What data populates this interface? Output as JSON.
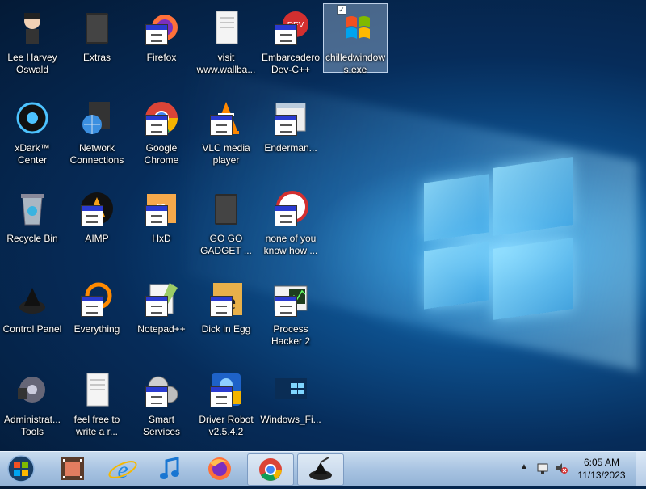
{
  "desktop": {
    "icons": [
      {
        "label": "Lee Harvey Oswald",
        "name": "desktop-icon-lee-harvey-oswald",
        "icon": "character-icon",
        "selected": false
      },
      {
        "label": "Extras",
        "name": "desktop-icon-extras",
        "icon": "dark-folder-icon",
        "selected": false
      },
      {
        "label": "Firefox",
        "name": "desktop-icon-firefox",
        "icon": "firefox-icon",
        "selected": false
      },
      {
        "label": "visit www.wallba...",
        "name": "desktop-icon-visit-wallba",
        "icon": "text-file-icon",
        "selected": false
      },
      {
        "label": "Embarcadero Dev-C++",
        "name": "desktop-icon-embarcadero-devcpp",
        "icon": "devcpp-icon",
        "selected": false
      },
      {
        "label": "chilledwindows.exe",
        "name": "desktop-icon-chilledwindows",
        "icon": "windows-flag-icon",
        "selected": true
      },
      {
        "label": "xDark™ Center",
        "name": "desktop-icon-xdark-center",
        "icon": "xdark-orb-icon",
        "selected": false
      },
      {
        "label": "Network Connections",
        "name": "desktop-icon-network-connections",
        "icon": "network-globe-icon",
        "selected": false
      },
      {
        "label": "Google Chrome",
        "name": "desktop-icon-google-chrome",
        "icon": "chrome-icon",
        "selected": false
      },
      {
        "label": "VLC media player",
        "name": "desktop-icon-vlc",
        "icon": "vlc-cone-icon",
        "selected": false
      },
      {
        "label": "Enderman...",
        "name": "desktop-icon-enderman",
        "icon": "app-window-icon",
        "selected": false
      },
      {
        "label": "Recycle Bin",
        "name": "desktop-icon-recycle-bin",
        "icon": "recycle-bin-icon",
        "selected": false
      },
      {
        "label": "AIMP",
        "name": "desktop-icon-aimp",
        "icon": "aimp-icon",
        "selected": false
      },
      {
        "label": "HxD",
        "name": "desktop-icon-hxd",
        "icon": "hxd-icon",
        "selected": false
      },
      {
        "label": "GO GO GADGET ...",
        "name": "desktop-icon-go-go-gadget",
        "icon": "dark-folder-icon",
        "selected": false
      },
      {
        "label": "none of you know how ...",
        "name": "desktop-icon-none-of-you",
        "icon": "red-circle-app-icon",
        "selected": false
      },
      {
        "label": "Control Panel",
        "name": "desktop-icon-control-panel",
        "icon": "control-panel-icon",
        "selected": false
      },
      {
        "label": "Everything",
        "name": "desktop-icon-everything",
        "icon": "everything-search-icon",
        "selected": false
      },
      {
        "label": "Notepad++",
        "name": "desktop-icon-notepadpp",
        "icon": "notepadpp-icon",
        "selected": false
      },
      {
        "label": "Dick in Egg",
        "name": "desktop-icon-dick-in-egg",
        "icon": "game-e-icon",
        "selected": false
      },
      {
        "label": "Process Hacker 2",
        "name": "desktop-icon-process-hacker",
        "icon": "process-monitor-icon",
        "selected": false
      },
      {
        "label": "Administrat... Tools",
        "name": "desktop-icon-admin-tools",
        "icon": "admin-tools-icon",
        "selected": false
      },
      {
        "label": "feel free to write a r...",
        "name": "desktop-icon-feel-free",
        "icon": "text-file-icon",
        "selected": false
      },
      {
        "label": "Smart Services",
        "name": "desktop-icon-smart-services",
        "icon": "gears-icon",
        "selected": false
      },
      {
        "label": "Driver Robot v2.5.4.2",
        "name": "desktop-icon-driver-robot",
        "icon": "driver-robot-icon",
        "selected": false
      },
      {
        "label": "Windows_Fi...",
        "name": "desktop-icon-windows-fi",
        "icon": "windows-wallpaper-icon",
        "selected": false
      }
    ]
  },
  "taskbar": {
    "pinned": [
      {
        "name": "taskbar-start-button",
        "icon": "windows-orb-icon",
        "active": false
      },
      {
        "name": "taskbar-filmstrip",
        "icon": "filmstrip-icon",
        "active": false
      },
      {
        "name": "taskbar-internet-explorer",
        "icon": "internet-explorer-icon",
        "active": false
      },
      {
        "name": "taskbar-music",
        "icon": "music-note-icon",
        "active": false
      },
      {
        "name": "taskbar-firefox",
        "icon": "firefox-icon",
        "active": false
      },
      {
        "name": "taskbar-chrome",
        "icon": "chrome-icon",
        "active": true
      },
      {
        "name": "taskbar-control-panel",
        "icon": "control-panel-icon",
        "active": true
      }
    ],
    "tray": {
      "time": "6:05 AM",
      "date": "11/13/2023"
    }
  },
  "colors": {
    "accent": "#0d4f8c",
    "taskbar": "#a9c4e2",
    "selection": "#cfe3ff"
  }
}
